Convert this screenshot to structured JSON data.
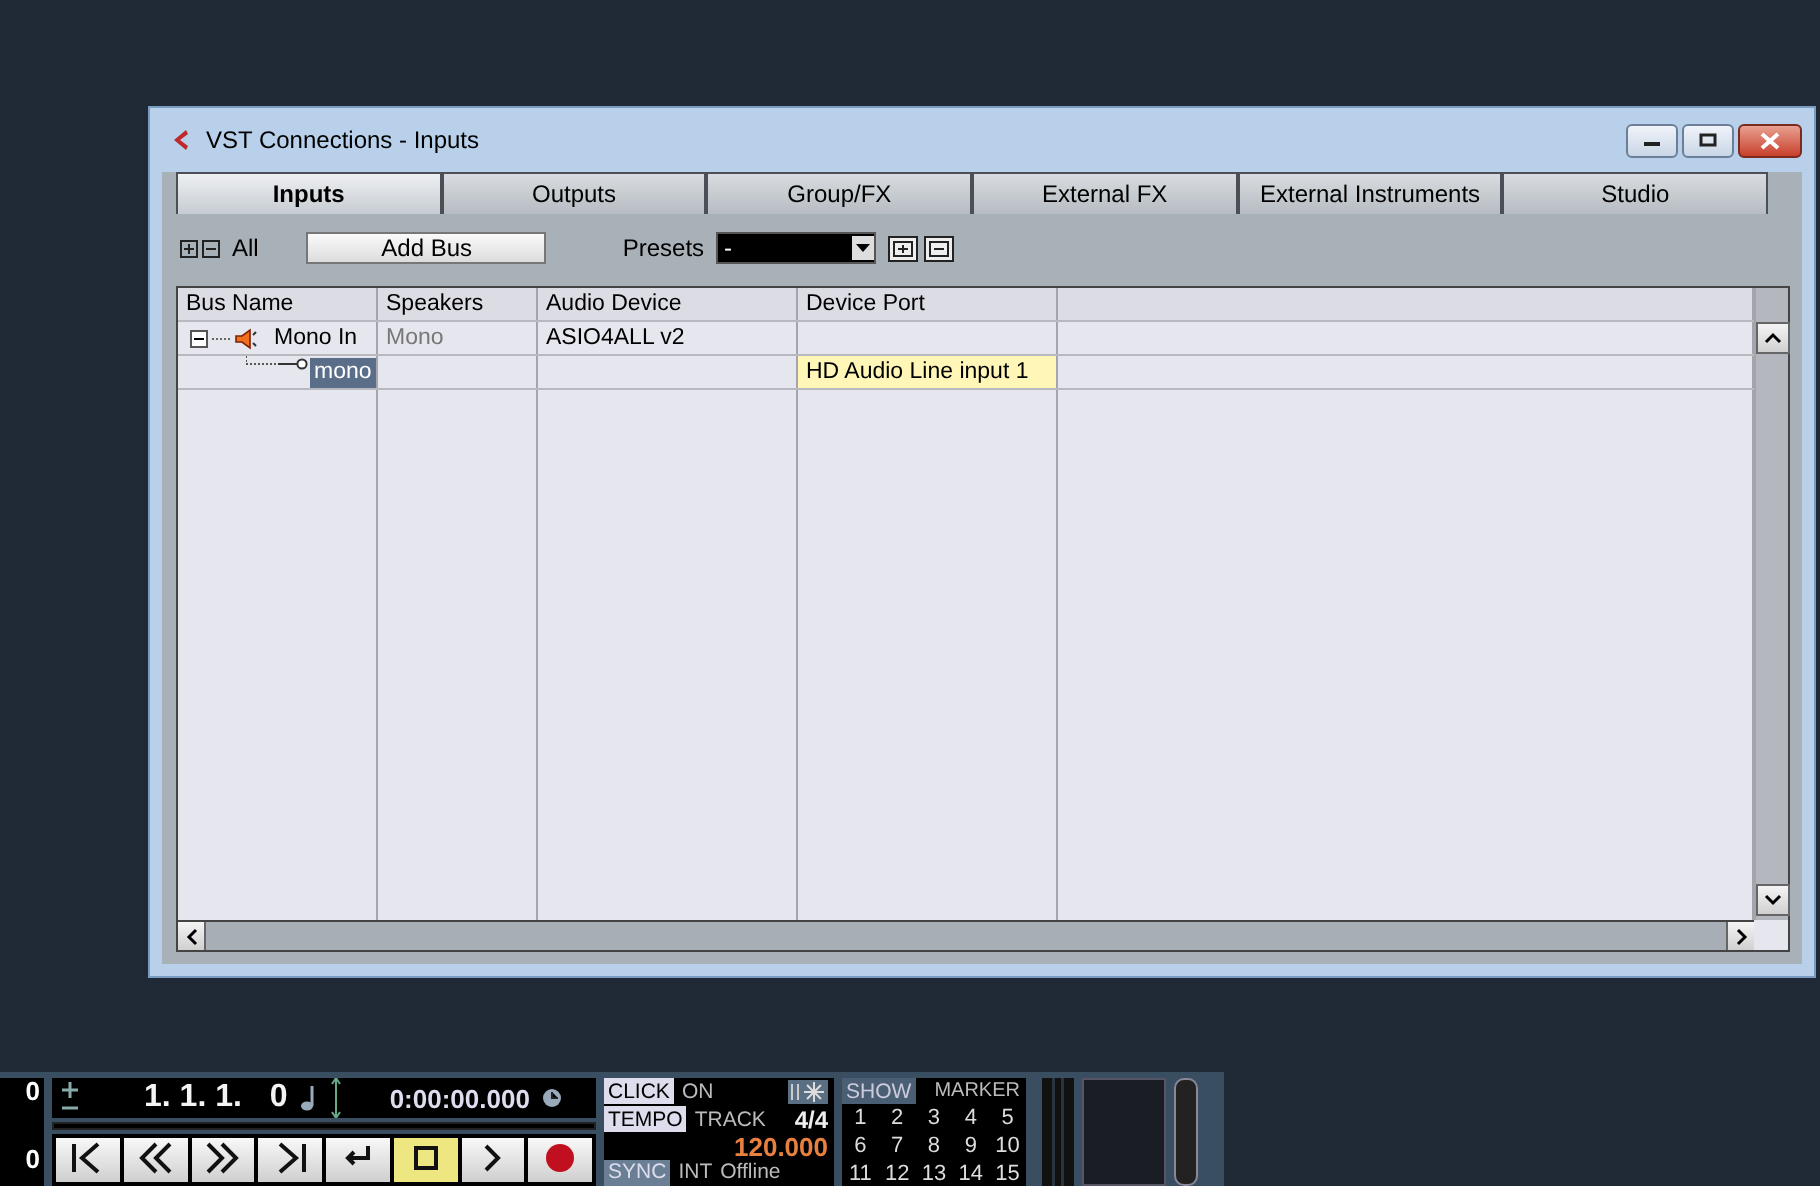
{
  "window": {
    "title": "VST Connections - Inputs"
  },
  "tabs": [
    {
      "label": "Inputs",
      "selected": true
    },
    {
      "label": "Outputs",
      "selected": false
    },
    {
      "label": "Group/FX",
      "selected": false
    },
    {
      "label": "External FX",
      "selected": false
    },
    {
      "label": "External Instruments",
      "selected": false
    },
    {
      "label": "Studio",
      "selected": false
    }
  ],
  "toolbar": {
    "all_label": "All",
    "add_bus": "Add Bus",
    "presets_label": "Presets",
    "presets_value": "-"
  },
  "table": {
    "columns": [
      "Bus Name",
      "Speakers",
      "Audio Device",
      "Device Port"
    ],
    "rows": [
      {
        "name": "Mono In",
        "speakers": "Mono",
        "audio_device": "ASIO4ALL v2",
        "expanded": true,
        "selected": false,
        "children": [
          {
            "name": "mono",
            "device_port": "HD Audio Line input 1",
            "selected": true
          }
        ]
      }
    ]
  },
  "transport": {
    "left_counters": [
      "0",
      "0"
    ],
    "position": "1. 1. 1.",
    "ticks": "0",
    "time": "0:00:00.000",
    "click": "CLICK",
    "click_state": "ON",
    "tempo": "TEMPO",
    "tempo_mode": "TRACK",
    "signature": "4/4",
    "bpm": "120.000",
    "sync": "SYNC",
    "sync_mode": "INT",
    "sync_state": "Offline",
    "show": "SHOW",
    "marker": "MARKER",
    "markers": [
      "1",
      "2",
      "3",
      "4",
      "5",
      "6",
      "7",
      "8",
      "9",
      "10",
      "11",
      "12",
      "13",
      "14",
      "15"
    ]
  }
}
